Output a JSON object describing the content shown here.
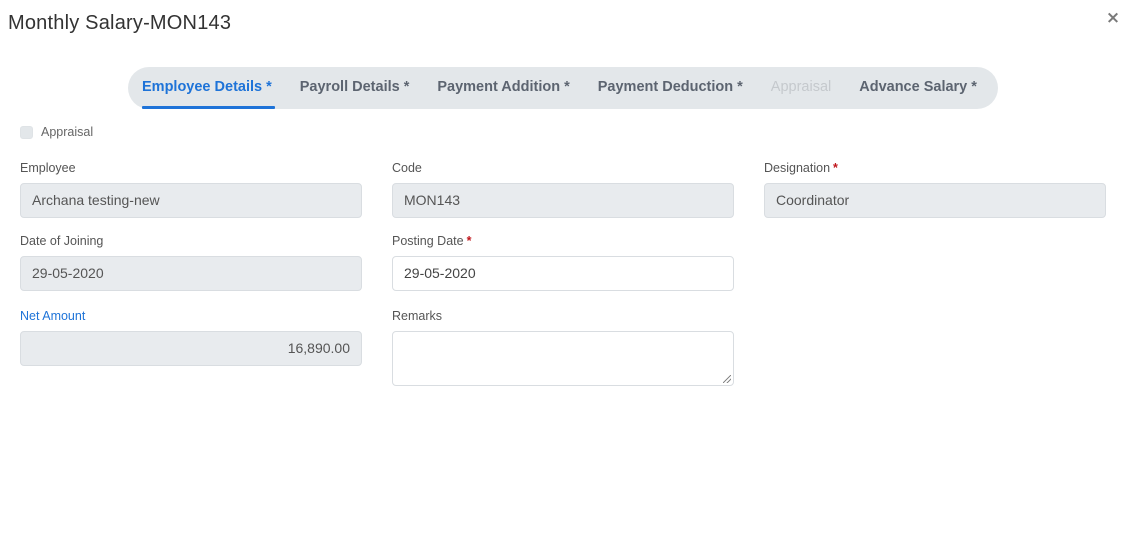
{
  "modal": {
    "title": "Monthly Salary-MON143",
    "close_glyph": "×"
  },
  "tabs": [
    {
      "label": "Employee Details *",
      "state": "active"
    },
    {
      "label": "Payroll Details *",
      "state": "normal"
    },
    {
      "label": "Payment Addition *",
      "state": "normal"
    },
    {
      "label": "Payment Deduction *",
      "state": "normal"
    },
    {
      "label": "Appraisal",
      "state": "disabled"
    },
    {
      "label": "Advance Salary *",
      "state": "normal"
    }
  ],
  "appraisal_checkbox": {
    "label": "Appraisal",
    "checked": false
  },
  "form": {
    "employee": {
      "label": "Employee",
      "value": "Archana testing-new"
    },
    "code": {
      "label": "Code",
      "value": "MON143"
    },
    "designation": {
      "label": "Designation",
      "required_mark": "*",
      "value": "Coordinator"
    },
    "date_of_joining": {
      "label": "Date of Joining",
      "value": "29-05-2020"
    },
    "posting_date": {
      "label": "Posting Date",
      "required_mark": "*",
      "value": "29-05-2020"
    },
    "net_amount": {
      "label": "Net Amount",
      "value": "16,890.00"
    },
    "remarks": {
      "label": "Remarks",
      "value": ""
    }
  },
  "colors": {
    "accent": "#1e73d8",
    "required": "#c0151b",
    "tabbar_bg": "#e3e7ea",
    "readonly_bg": "#e8ebee"
  }
}
